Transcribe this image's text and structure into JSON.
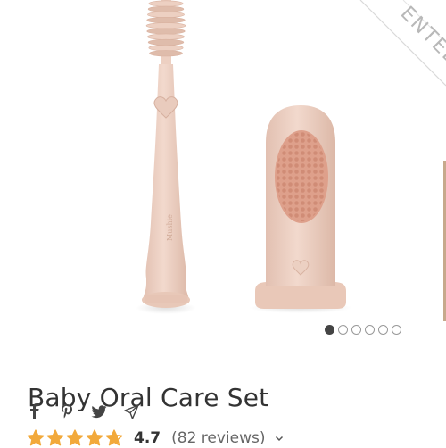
{
  "badge": {
    "text": "ENTED"
  },
  "product": {
    "brand_mark": "Mushie",
    "title": "Baby Oral Care Set"
  },
  "carousel": {
    "count": 6,
    "active_index": 0
  },
  "share": {
    "icons": [
      "facebook-icon",
      "pinterest-icon",
      "twitter-icon",
      "send-icon"
    ]
  },
  "rating": {
    "value": "4.7",
    "stars": 4.7,
    "reviews_label": "(82 reviews)"
  },
  "colors": {
    "silicone": "#edd0c2",
    "silicone_shade": "#dfbcab",
    "bristle": "#d99983",
    "star": "#f2a93b",
    "badge_text": "#b8b8b8"
  }
}
